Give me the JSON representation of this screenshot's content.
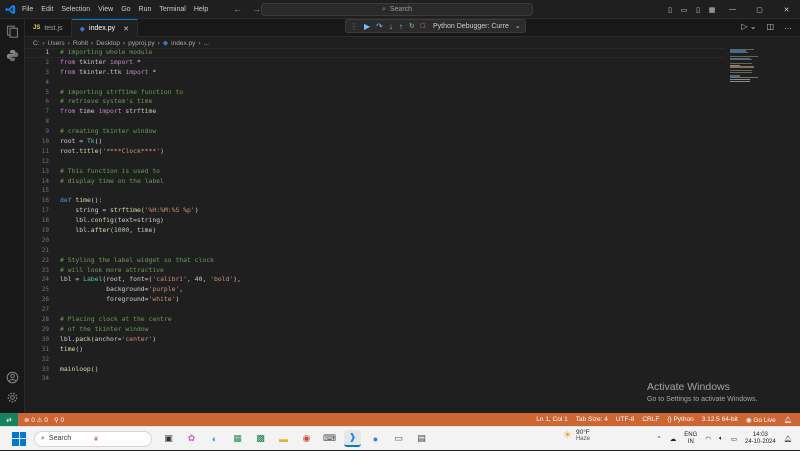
{
  "menu": [
    "File",
    "Edit",
    "Selection",
    "View",
    "Go",
    "Run",
    "Terminal",
    "Help"
  ],
  "search": {
    "label": "Search"
  },
  "tabs": [
    {
      "label": "test.js",
      "type": "js"
    },
    {
      "label": "index.py",
      "type": "py",
      "active": true
    }
  ],
  "debug": {
    "config": "Python Debugger: Curre"
  },
  "breadcrumb": [
    "C:",
    "Users",
    "Rohit",
    "Desktop",
    "pyproj.py",
    "index.py",
    "..."
  ],
  "code": {
    "line_numbers": [
      "1",
      "2",
      "3",
      "4",
      "5",
      "6",
      "7",
      "8",
      "9",
      "10",
      "11",
      "12",
      "13",
      "14",
      "15",
      "16",
      "17",
      "18",
      "19",
      "20",
      "21",
      "22",
      "23",
      "24",
      "25",
      "26",
      "27",
      "28",
      "29",
      "30",
      "31",
      "32",
      "33",
      "34"
    ],
    "lines": [
      "# importing whole module",
      "from tkinter import *",
      "from tkinter.ttk import *",
      "",
      "# importing strftime function to",
      "# retrieve system's time",
      "from time import strftime",
      "",
      "# creating tkinter window",
      "root = Tk()",
      "root.title('****Clock****')",
      "",
      "# This function is used to",
      "# display time on the label",
      "",
      "def time():",
      "    string = strftime('%H:%M:%S %p')",
      "    lbl.config(text=string)",
      "    lbl.after(1000, time)",
      "",
      "",
      "# Styling the label widget so that clock",
      "# will look more attractive",
      "lbl = Label(root, font=('calibri', 40, 'bold'),",
      "            background='purple',",
      "            foreground='white')",
      "",
      "# Placing clock at the centre",
      "# of the tkinter window",
      "lbl.pack(anchor='center')",
      "time()",
      "",
      "mainloop()",
      ""
    ]
  },
  "activate": {
    "title": "Activate Windows",
    "subtitle": "Go to Settings to activate Windows."
  },
  "status": {
    "problems": "0",
    "warnings": "0",
    "ln_col": "Ln 1, Col 1",
    "tab_size": "Tab Size: 4",
    "encoding": "UTF-8",
    "eol": "CRLF",
    "language": "Python",
    "version": "3.12.5 64-bit",
    "golive": "Go Live"
  },
  "taskbar": {
    "search": "Search",
    "weather_temp": "90°F",
    "weather_desc": "Haze",
    "lang1": "ENG",
    "lang2": "IN",
    "time": "14:03",
    "date": "24-10-2024"
  }
}
